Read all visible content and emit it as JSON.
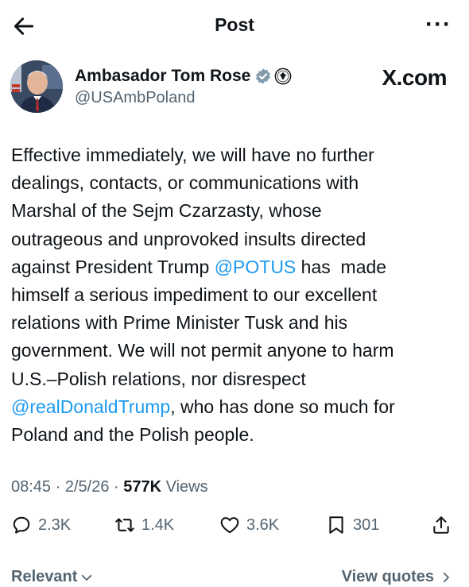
{
  "header": {
    "title": "Post"
  },
  "author": {
    "name": "Ambasador Tom Rose",
    "handle": "@USAmbPoland"
  },
  "watermark": "X.com",
  "post": {
    "lines": [
      [
        {
          "t": "Effective immediately, we will have no further"
        }
      ],
      [
        {
          "t": "dealings, contacts, or communications with"
        }
      ],
      [
        {
          "t": "Marshal of the Sejm Czarzasty, whose"
        }
      ],
      [
        {
          "t": "outrageous and unprovoked insults directed"
        }
      ],
      [
        {
          "t": "against President Trump "
        },
        {
          "t": "@POTUS",
          "m": true
        },
        {
          "t": " has  made"
        }
      ],
      [
        {
          "t": "himself a serious impediment to our excellent"
        }
      ],
      [
        {
          "t": "relations with Prime Minister Tusk and his"
        }
      ],
      [
        {
          "t": "government. We will not permit anyone to harm"
        }
      ],
      [
        {
          "t": "U.S.–Polish relations, nor disrespect"
        }
      ],
      [
        {
          "t": "@realDonaldTrump",
          "m": true
        },
        {
          "t": ", who has done so much for"
        }
      ],
      [
        {
          "t": "Poland and the Polish people."
        }
      ]
    ]
  },
  "meta": {
    "time": "08:45",
    "date": "2/5/26",
    "views_count": "577K",
    "views_label": "Views"
  },
  "actions": {
    "replies": "2.3K",
    "reposts": "1.4K",
    "likes": "3.6K",
    "bookmarks": "301"
  },
  "footer": {
    "sort_label": "Relevant",
    "quotes_label": "View quotes"
  },
  "colors": {
    "link": "#1d9bf0",
    "secondary_text": "#536471",
    "verified_badge": "#829aab"
  }
}
